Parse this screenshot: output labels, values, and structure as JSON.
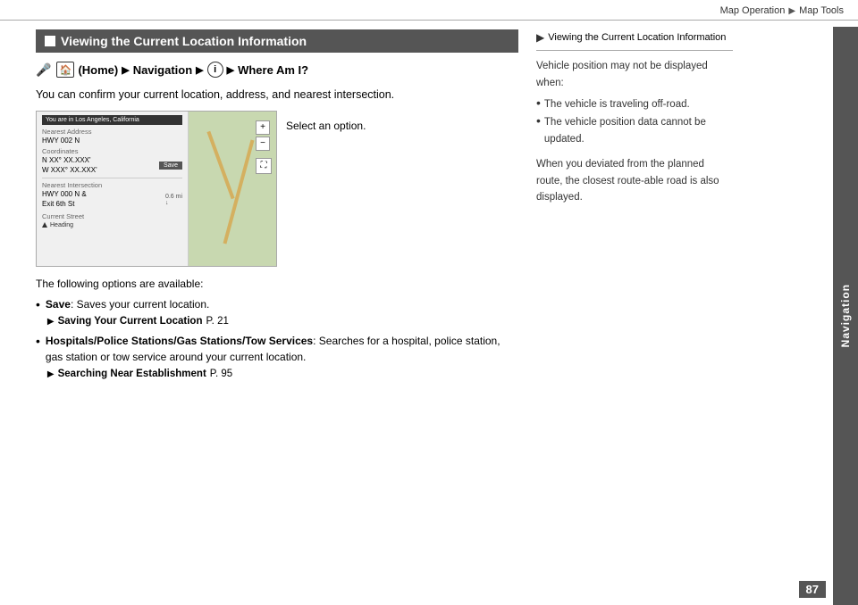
{
  "header": {
    "breadcrumb": [
      "Map Operation",
      "Map Tools"
    ],
    "arrow": "▶"
  },
  "sidebar": {
    "label": "Navigation"
  },
  "page_number": "87",
  "section": {
    "title": "Viewing the Current Location Information",
    "nav_path": {
      "voice_symbol": "🎤",
      "home_label": "HOME",
      "arrow1": "▶",
      "nav_label": "Navigation",
      "arrow2": "▶",
      "info_label": "i",
      "arrow3": "▶",
      "where_label": "Where Am I?"
    },
    "description": "You can confirm your current location, address, and nearest intersection.",
    "select_option": "Select an option.",
    "screenshot": {
      "location_bar": "You are in Los Angeles, California",
      "nearest_address_label": "Nearest Address",
      "nearest_address_value": "HWY 002 N",
      "coordinates_label": "Coordinates",
      "coord1": "N XX° XX.XXX'",
      "coord2": "W XXX° XX.XXX'",
      "save_btn": "Save",
      "nearest_intersection_label": "Nearest Intersection",
      "intersection_distance": "0.6 mi",
      "intersection_value": "HWY 000 N &\nExit 6th St",
      "current_street_label": "Current Street",
      "heading_label": "Heading"
    },
    "options_title": "The following options are available:",
    "options": [
      {
        "term": "Save",
        "text": ": Saves your current location.",
        "ref_text": "Saving Your Current Location",
        "ref_page": "P. 21"
      },
      {
        "term": "Hospitals/Police Stations/Gas Stations/Tow Services",
        "text": ": Searches for a hospital, police station, gas station or tow service around your current location.",
        "ref_text": "Searching Near Establishment",
        "ref_page": "P. 95"
      }
    ]
  },
  "right_panel": {
    "header_icon": "▶",
    "header_text": "Viewing the Current Location Information",
    "intro": "Vehicle position may not be displayed when:",
    "bullets": [
      "The vehicle is traveling off-road.",
      "The vehicle position data cannot be updated."
    ],
    "note": "When you deviated from the planned route, the closest route-able road is also displayed."
  }
}
